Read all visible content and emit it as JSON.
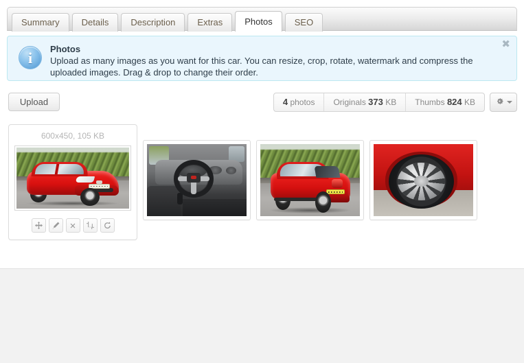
{
  "tabs": [
    {
      "label": "Summary",
      "active": false
    },
    {
      "label": "Details",
      "active": false
    },
    {
      "label": "Description",
      "active": false
    },
    {
      "label": "Extras",
      "active": false
    },
    {
      "label": "Photos",
      "active": true
    },
    {
      "label": "SEO",
      "active": false
    }
  ],
  "alert": {
    "icon": "info-icon",
    "title": "Photos",
    "text": "Upload as many images as you want for this car. You can resize, crop, rotate, watermark and compress the uploaded images. Drag & drop to change their order.",
    "close_label": "✖",
    "background": "#eaf6fd",
    "border": "#bce8f1"
  },
  "toolbar": {
    "upload_label": "Upload",
    "stats": [
      {
        "value": "4",
        "unit": "photos"
      },
      {
        "prefix": "Originals",
        "value": "373",
        "unit": "KB"
      },
      {
        "prefix": "Thumbs",
        "value": "824",
        "unit": "KB"
      }
    ],
    "settings_icon": "gear-icon",
    "settings_caret": "chevron-down-icon"
  },
  "photos": [
    {
      "label": "600x450, 105 KB",
      "alt": "Red SEAT Ibiza hatchback front three-quarter view",
      "selected": true,
      "actions": [
        {
          "name": "move-handle",
          "title": "Move"
        },
        {
          "name": "edit-button",
          "title": "Edit"
        },
        {
          "name": "delete-button",
          "title": "Delete"
        },
        {
          "name": "crop-button",
          "title": "Crop"
        },
        {
          "name": "rotate-button",
          "title": "Rotate"
        }
      ]
    },
    {
      "label": "",
      "alt": "Car interior dashboard and steering wheel",
      "selected": false
    },
    {
      "label": "",
      "alt": "Red hatchback rear three-quarter view",
      "selected": false
    },
    {
      "label": "",
      "alt": "Close-up of alloy wheel and tyre",
      "selected": false
    }
  ],
  "colors": {
    "page_background": "#f2f2f2",
    "content_background": "#ffffff",
    "alert_background": "#eaf6fd",
    "alert_border": "#bce8f1",
    "tab_active_background": "#ffffff",
    "muted_text": "#b5b5b5"
  }
}
